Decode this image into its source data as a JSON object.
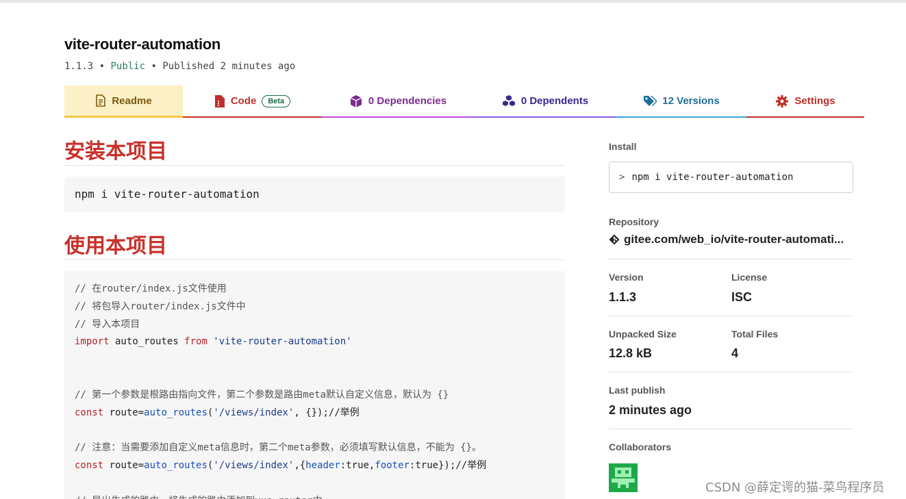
{
  "package": {
    "name": "vite-router-automation",
    "version": "1.1.3",
    "visibility": "Public",
    "separator": "•",
    "published": "Published 2 minutes ago"
  },
  "tabs": [
    {
      "label": "Readme",
      "icon": "document-icon"
    },
    {
      "label": "Code",
      "badge": "Beta",
      "icon": "file-code-icon"
    },
    {
      "label": "0 Dependencies",
      "icon": "cube-icon"
    },
    {
      "label": "0 Dependents",
      "icon": "cubes-icon"
    },
    {
      "label": "12 Versions",
      "icon": "tags-icon"
    },
    {
      "label": "Settings",
      "icon": "gear-icon"
    }
  ],
  "readme": {
    "heading_install": "安装本项目",
    "install_code": "npm i vite-router-automation",
    "heading_usage": "使用本项目",
    "code_lines": {
      "l1": "// 在router/index.js文件使用",
      "l2": "// 将包导入router/index.js文件中",
      "l3": "// 导入本项目",
      "l4_kw": "import",
      "l4_mid": " auto_routes ",
      "l4_from": "from",
      "l4_str": " 'vite-router-automation'",
      "l7": "// 第一个参数是根路由指向文件，第二个参数是路由meta默认自定义信息，默认为 {}",
      "l8_kw": "const",
      "l8_a": " route=",
      "l8_fn": "auto_routes",
      "l8_b": "(",
      "l8_str": "'/views/index'",
      "l8_c": ", {});//举例",
      "l10": "// 注意：当需要添加自定义meta信息时，第二个meta参数，必须填写默认信息，不能为 {}。",
      "l11_kw": "const",
      "l11_a": " route=",
      "l11_fn": "auto_routes",
      "l11_b": "(",
      "l11_str": "'/views/index'",
      "l11_c": ",{",
      "l11_k1": "header",
      "l11_v1": ":true,",
      "l11_k2": "footer",
      "l11_v2": ":true});//举例",
      "l13": "// 导出生成的路由，将生成的路由添加到vue-router中"
    }
  },
  "sidebar": {
    "install_label": "Install",
    "install_chevron": ">",
    "install_cmd": "npm i vite-router-automation",
    "repository_label": "Repository",
    "repository_value": "gitee.com/web_io/vite-router-automati...",
    "version_label": "Version",
    "version_value": "1.1.3",
    "license_label": "License",
    "license_value": "ISC",
    "size_label": "Unpacked Size",
    "size_value": "12.8 kB",
    "files_label": "Total Files",
    "files_value": "4",
    "last_publish_label": "Last publish",
    "last_publish_value": "2 minutes ago",
    "collaborators_label": "Collaborators"
  },
  "watermark": "CSDN @薛定谔的猫-菜鸟程序员",
  "colors": {
    "readme_tab_bg": "#fbf0c6",
    "heading_red": "#c8302a",
    "public_green": "#2a7a5a"
  }
}
